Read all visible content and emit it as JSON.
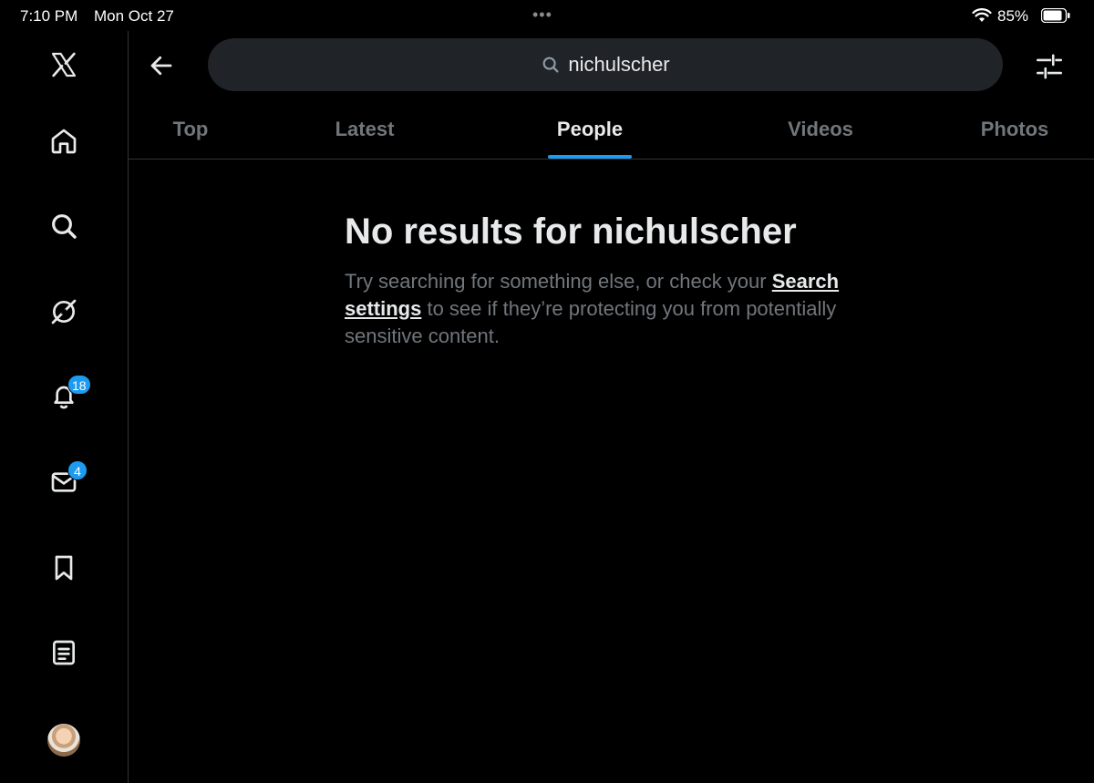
{
  "status_bar": {
    "time": "7:10 PM",
    "date": "Mon Oct 27",
    "battery": "85%",
    "dots": "•••"
  },
  "sidebar": {
    "items": [
      {
        "icon": "x-logo-icon"
      },
      {
        "icon": "home-icon"
      },
      {
        "icon": "search-icon"
      },
      {
        "icon": "grok-icon"
      },
      {
        "icon": "bell-icon",
        "badge": "18"
      },
      {
        "icon": "mail-icon",
        "badge": "4"
      },
      {
        "icon": "bookmark-icon"
      },
      {
        "icon": "lists-icon"
      }
    ]
  },
  "search": {
    "value": "nichulscher"
  },
  "tabs": [
    {
      "label": "Top"
    },
    {
      "label": "Latest"
    },
    {
      "label": "People",
      "active": true
    },
    {
      "label": "Videos"
    },
    {
      "label": "Photos"
    }
  ],
  "empty_state": {
    "title": "No results for nichulscher",
    "text_before": "Try searching for something else, or check your ",
    "link": "Search settings",
    "text_after": " to see if they’re protecting you from potentially sensitive content."
  },
  "colors": {
    "accent": "#1d9bf0",
    "muted": "#71767b",
    "text": "#e7e9ea"
  }
}
